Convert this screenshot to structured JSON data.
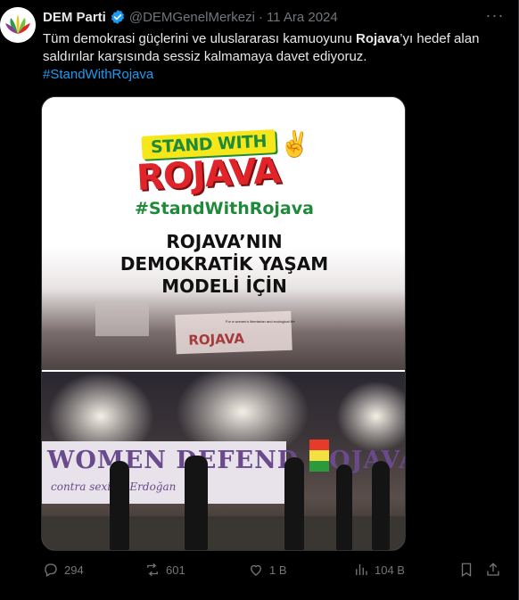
{
  "author": {
    "name": "DEM Parti",
    "handle": "@DEMGenelMerkezi",
    "separator": "·",
    "date": "11 Ara 2024"
  },
  "tweet": {
    "text_part1": "Tüm demokrasi güçlerini ve uluslararası kamuoyunu ",
    "text_bold": "Rojava",
    "text_part2": "’yı hedef alan saldırılar karşısında sessiz kalmamaya davet ediyoruz.",
    "hashtag": "#StandWithRojava"
  },
  "image": {
    "logo_top": "STAND WITH",
    "logo_main": "ROJAVA",
    "hashtag": "#StandWithRojava",
    "heading_line1": "ROJAVA’NIN",
    "heading_line2": "DEMOKRATİK YAŞAM",
    "heading_line3": "MODELİ İÇİN",
    "small_text": "For a women's libertarian and ecological life",
    "banner_text": "ROJAVA",
    "protest_banner_main": "WOMEN DEFEND ROJAVA",
    "protest_banner_sub": "contra sexism      Erdoğan"
  },
  "actions": {
    "replies": "294",
    "reposts": "601",
    "likes": "1 B",
    "views": "104 B"
  },
  "colors": {
    "background": "#000000",
    "text": "#e7e9ea",
    "muted": "#71767b",
    "link": "#1d9bf0",
    "verified": "#1d9bf0"
  },
  "icons": [
    "more-icon",
    "verified-badge-icon",
    "reply-icon",
    "repost-icon",
    "like-icon",
    "views-icon",
    "bookmark-icon",
    "share-icon"
  ]
}
